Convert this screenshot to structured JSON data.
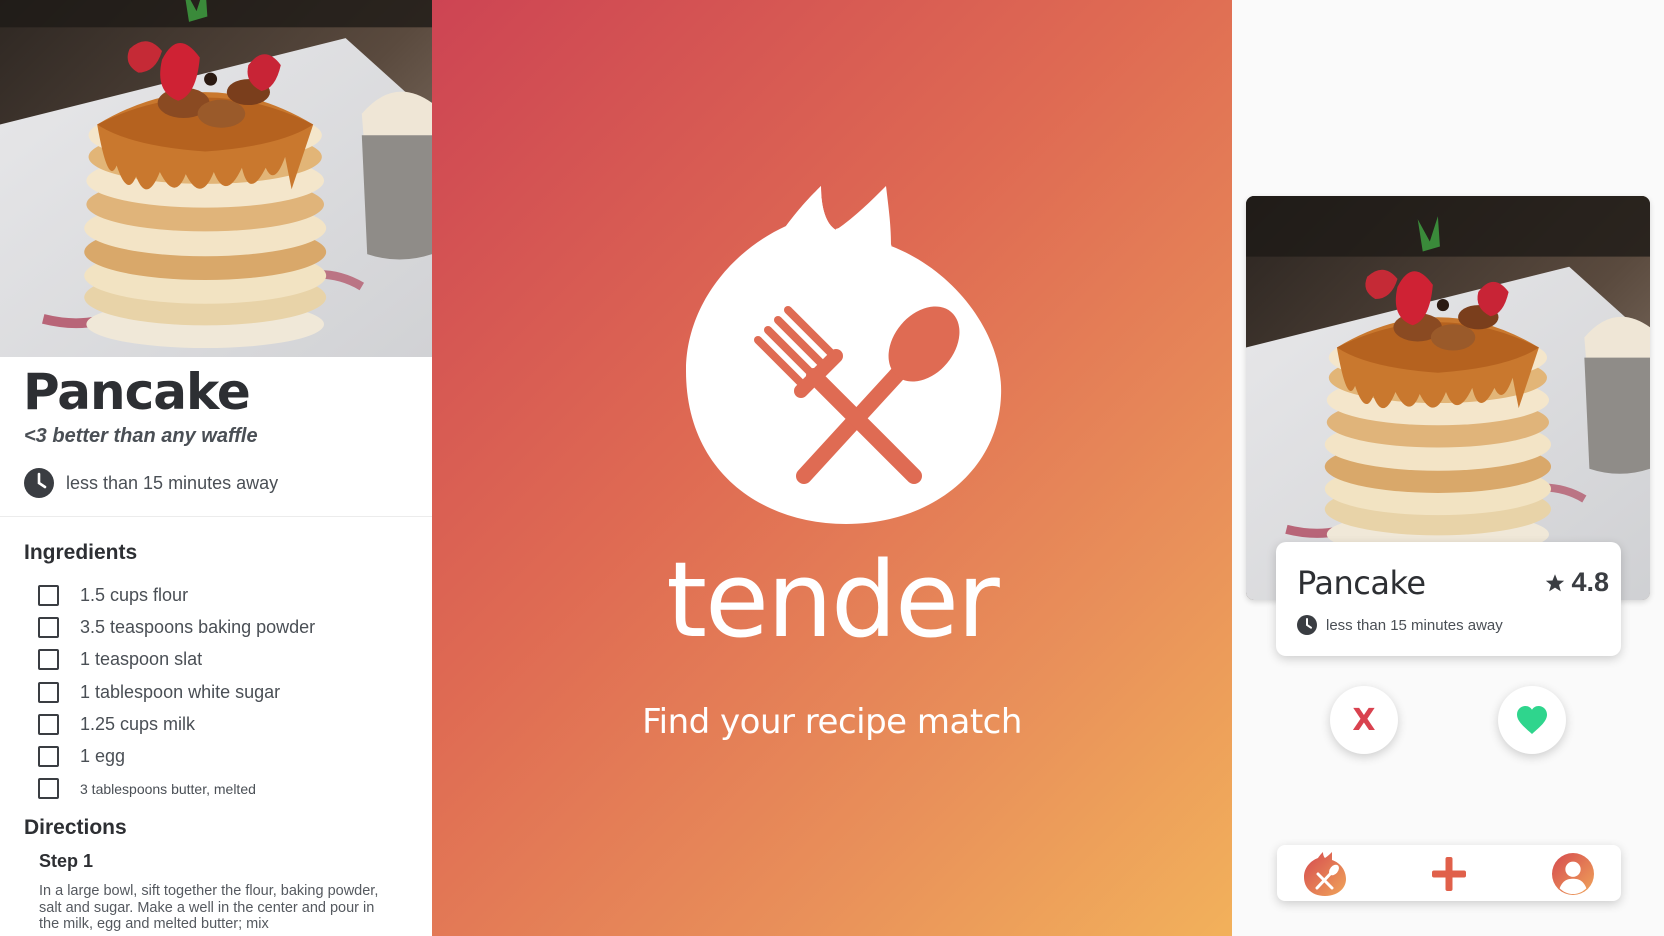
{
  "recipe": {
    "title": "Pancake",
    "tagline": "<3 better than any waffle",
    "time": "less than 15 minutes away",
    "ingredients_heading": "Ingredients",
    "ingredients": [
      "1.5 cups flour",
      "3.5 teaspoons baking powder",
      "1 teaspoon slat",
      "1 tablespoon white sugar",
      "1.25 cups milk",
      "1 egg",
      "3 tablespoons butter, melted"
    ],
    "directions_heading": "Directions",
    "step_label": "Step 1",
    "step_text": "In a large bowl, sift together the flour, baking powder, salt and sugar. Make a well in the center and pour in the milk, egg and melted butter; mix"
  },
  "splash": {
    "brand": "tender",
    "slogan": "Find your recipe match",
    "logo_icon": "fork-spoon-flame-icon"
  },
  "card": {
    "name": "Pancake",
    "rating": "4.8",
    "time": "less than 15 minutes away"
  },
  "actions": {
    "nope_glyph": "X",
    "like_icon": "heart-icon"
  },
  "tabbar": {
    "items": [
      "home-logo-icon",
      "plus-icon",
      "profile-icon"
    ]
  },
  "colors": {
    "gradient_start": "#cd4453",
    "gradient_end": "#f2b15b",
    "accent_red": "#d9424f",
    "accent_green": "#2fd58d",
    "accent_orange": "#e0604a",
    "text_dark": "#2d2f33"
  }
}
